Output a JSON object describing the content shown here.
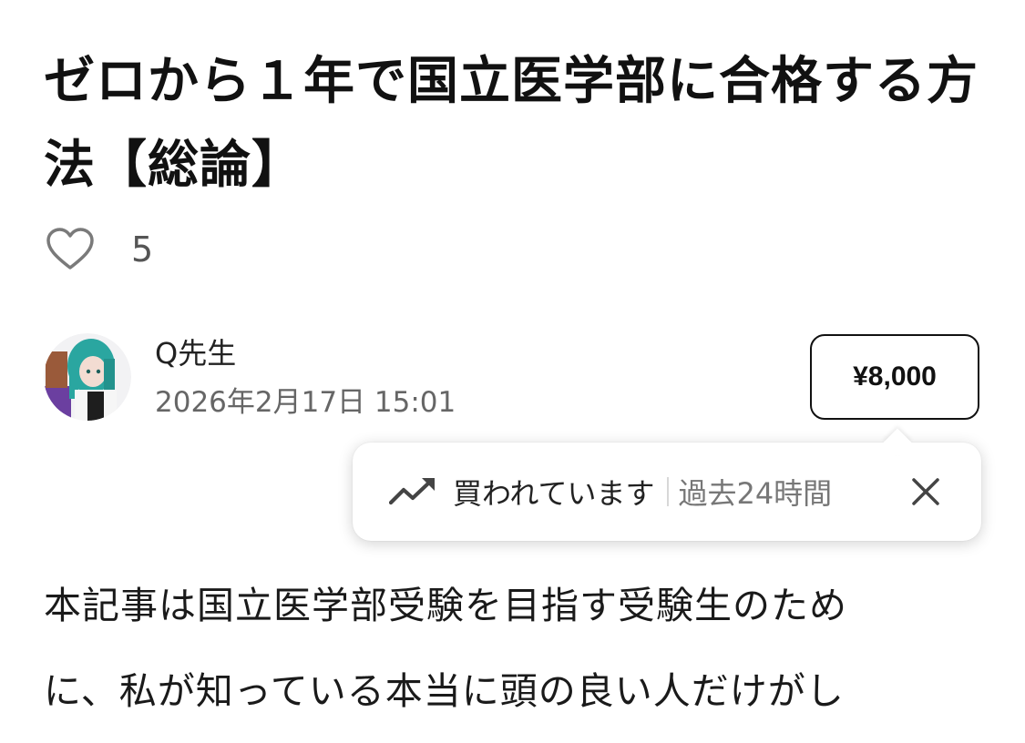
{
  "article": {
    "title": "ゼロから１年で国立医学部に合格する方法【総論】",
    "likes": "5",
    "body_line_1": "本記事は国立医学部受験を目指す受験生のため",
    "body_line_2": "に、私が知っている本当に頭の良い人だけがし"
  },
  "author": {
    "name": "Q先生",
    "date": "2026年2月17日 15:01"
  },
  "purchase": {
    "price": "¥8,000"
  },
  "tooltip": {
    "label": "買われています",
    "period": "過去24時間"
  },
  "icons": {
    "like": "heart-outline-icon",
    "trend": "trending-up-icon",
    "close": "close-x-icon"
  },
  "colors": {
    "text": "#111111",
    "muted": "#666666",
    "icon": "#777777",
    "avatar_bg": "#6b3fa0",
    "avatar_hair": "#2aa6a0"
  }
}
